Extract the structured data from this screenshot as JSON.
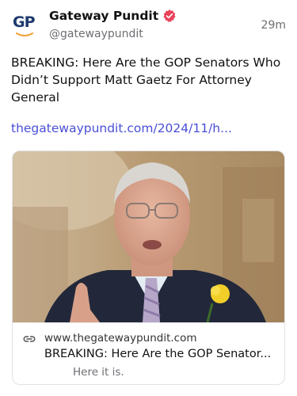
{
  "post": {
    "author_name": "Gateway Pundit",
    "author_handle": "@gatewaypundit",
    "avatar_text": "GP",
    "timestamp": "29m",
    "text": "BREAKING: Here Are the GOP Senators Who Didn’t Support Matt Gaetz For Attorney General",
    "link_text": "thegatewaypundit.com/2024/11/h..."
  },
  "link_card": {
    "domain": "www.thegatewaypundit.com",
    "title": "BREAKING: Here Are the GOP Senator...",
    "description": "Here it is."
  },
  "colors": {
    "link": "#4a4fd6",
    "verified_badge": "#e9425a",
    "avatar_blue": "#1e3a6e",
    "avatar_orange": "#f0a130",
    "secondary_text": "#6e6e73"
  },
  "icons": {
    "verified": "verified-badge-icon",
    "link": "link-chain-icon"
  }
}
